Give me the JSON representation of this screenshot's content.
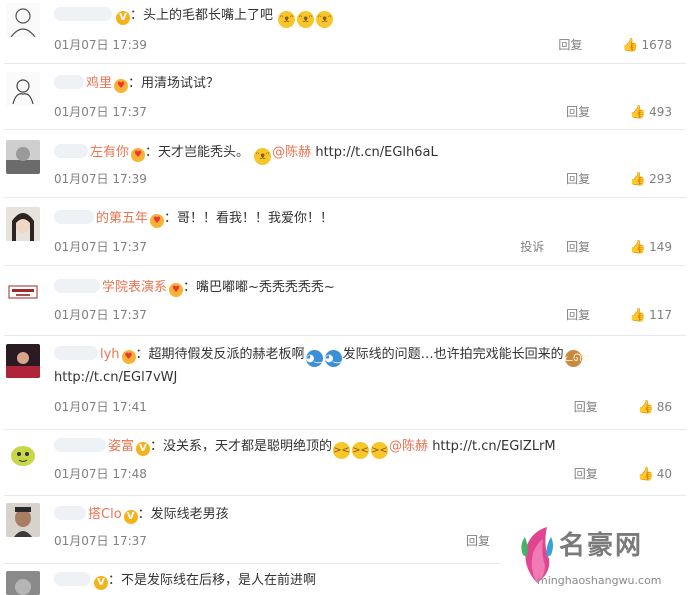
{
  "colors": {
    "username": "#eb7350",
    "meta": "#808080",
    "text": "#333333",
    "vip_badge": "#f7b21b"
  },
  "comments": [
    {
      "user": "",
      "verified": true,
      "text": "：头上的毛都长嘴上了吧",
      "emojis": [
        "dog-emoji",
        "dog-emoji",
        "dog-emoji"
      ],
      "time": "01月07日 17:39",
      "reply": "回复",
      "likes": "1678"
    },
    {
      "user": "鸡里",
      "heart": true,
      "text": "：用清场试试？",
      "time": "01月07日 17:37",
      "reply": "回复",
      "likes": "493"
    },
    {
      "user": "左有你",
      "heart": true,
      "text": "：天才岂能秃头。",
      "mention": "@陈赫",
      "link": "http://t.cn/EGlh6aL",
      "time": "01月07日 17:39",
      "reply": "回复",
      "likes": "293"
    },
    {
      "user": "的第五年",
      "heart": true,
      "text": "：哥！！看我！！我爱你！！",
      "time": "01月07日 17:37",
      "report": "投诉",
      "reply": "回复",
      "likes": "149"
    },
    {
      "user": "学院表演系",
      "heart": true,
      "text": "：嘴巴嘟嘟~秃秃秃秃秃~",
      "time": "01月07日 17:37",
      "reply": "回复",
      "likes": "117"
    },
    {
      "user": "lyh",
      "heart": true,
      "text": "：超期待假发反派的赫老板啊",
      "text2": "发际线的问题…也许拍完戏能长回来的",
      "link": "http://t.cn/EGl7vWJ",
      "time": "01月07日 17:41",
      "reply": "回复",
      "likes": "86"
    },
    {
      "user": "姿富",
      "verified": true,
      "text": "：没关系，天才都是聪明绝顶的",
      "mention": "@陈赫",
      "link": "http://t.cn/EGlZLrM",
      "time": "01月07日 17:48",
      "reply": "回复",
      "likes": "40"
    },
    {
      "user": "搭Clo",
      "verified": true,
      "text": "：发际线老男孩",
      "time": "01月07日 17:37",
      "reply": "回复"
    },
    {
      "user": "",
      "verified": true,
      "text": "：不是发际线在后移，是人在前进啊"
    }
  ],
  "watermark": {
    "title": "名豪网",
    "url": "minghaoshangwu.com"
  }
}
